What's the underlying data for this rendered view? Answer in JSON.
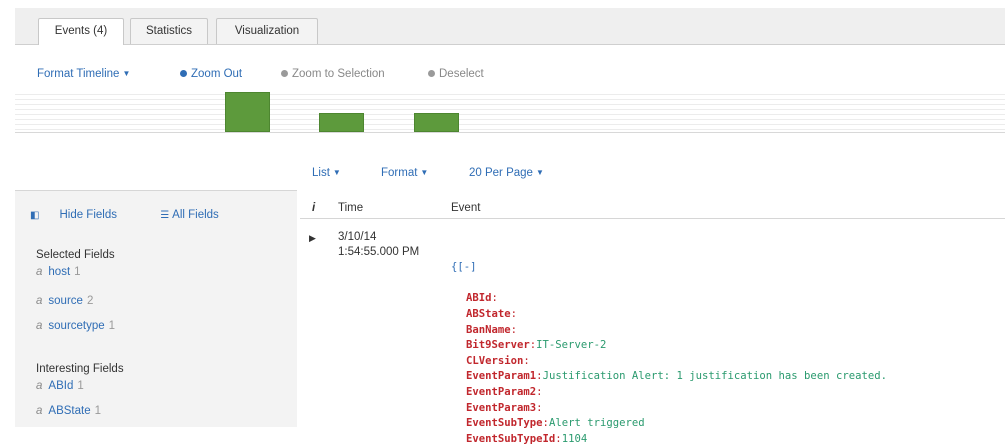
{
  "tabs": [
    {
      "label": "Events (4)",
      "active": true
    },
    {
      "label": "Statistics",
      "active": false
    },
    {
      "label": "Visualization",
      "active": false
    }
  ],
  "timeline_controls": {
    "format_timeline": "Format Timeline",
    "zoom_out": "Zoom Out",
    "zoom_to_selection": "Zoom to Selection",
    "deselect": "Deselect"
  },
  "timeline_bars": [
    {
      "level": 1.0
    },
    {
      "level": 0.47
    },
    {
      "level": 0.47
    }
  ],
  "toolbar": {
    "list": "List",
    "format": "Format",
    "per_page": "20 Per Page"
  },
  "fields_panel": {
    "hide_fields": "Hide Fields",
    "all_fields": "All Fields",
    "selected_title": "Selected Fields",
    "selected": [
      {
        "type": "a",
        "name": "host",
        "count": "1"
      },
      {
        "type": "a",
        "name": "source",
        "count": "2"
      },
      {
        "type": "a",
        "name": "sourcetype",
        "count": "1"
      }
    ],
    "interesting_title": "Interesting Fields",
    "interesting": [
      {
        "type": "a",
        "name": "ABId",
        "count": "1"
      },
      {
        "type": "a",
        "name": "ABState",
        "count": "1"
      }
    ]
  },
  "events_table": {
    "col_info": "i",
    "col_time": "Time",
    "col_event": "Event",
    "row": {
      "date": "3/10/14",
      "time": "1:54:55.000 PM",
      "brace": "{[-]",
      "fields": [
        {
          "key": "ABId",
          "value": ""
        },
        {
          "key": "ABState",
          "value": ""
        },
        {
          "key": "BanName",
          "value": ""
        },
        {
          "key": "Bit9Server",
          "value": "IT-Server-2"
        },
        {
          "key": "CLVersion",
          "value": ""
        },
        {
          "key": "EventParam1",
          "value": "Justification Alert: 1 justification has been created."
        },
        {
          "key": "EventParam2",
          "value": ""
        },
        {
          "key": "EventParam3",
          "value": ""
        },
        {
          "key": "EventSubType",
          "value": "Alert triggered"
        },
        {
          "key": "EventSubTypeId",
          "value": "1104"
        }
      ]
    }
  },
  "colors": {
    "accent": "#2f6db5",
    "bar": "#5d9a3c",
    "json_key": "#c1272d",
    "json_value": "#2a9a6e"
  }
}
